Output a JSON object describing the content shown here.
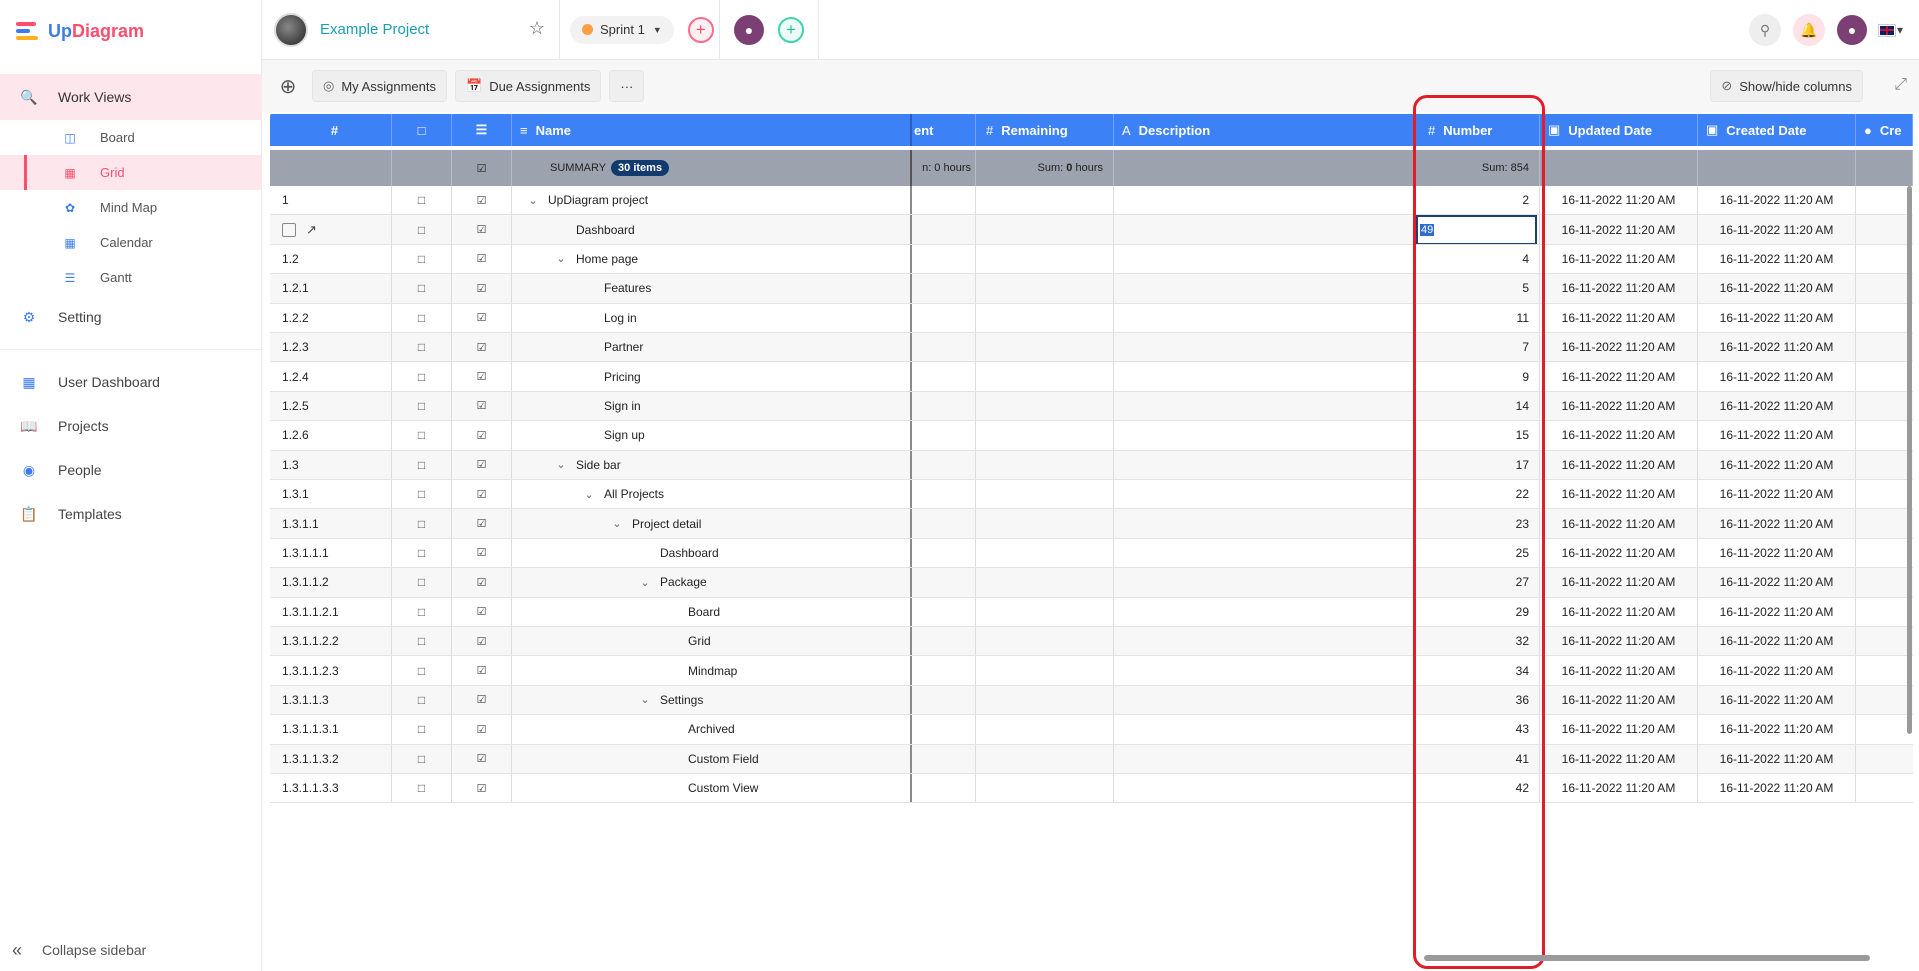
{
  "app": {
    "logo_text_a": "Up",
    "logo_text_b": "Diagram"
  },
  "sidebar": {
    "work_views": "Work Views",
    "sub_items": [
      {
        "label": "Board",
        "icon": "board-icon"
      },
      {
        "label": "Grid",
        "icon": "grid-icon",
        "active": true
      },
      {
        "label": "Mind Map",
        "icon": "mindmap-icon"
      },
      {
        "label": "Calendar",
        "icon": "calendar-icon"
      },
      {
        "label": "Gantt",
        "icon": "gantt-icon"
      }
    ],
    "setting": "Setting",
    "user_dashboard": "User Dashboard",
    "projects": "Projects",
    "people": "People",
    "templates": "Templates",
    "collapse": "Collapse sidebar"
  },
  "topbar": {
    "project_name": "Example Project",
    "sprint": "Sprint 1"
  },
  "toolbar": {
    "my_assignments": "My Assignments",
    "due_assignments": "Due Assignments",
    "more": "···",
    "show_hide": "Show/hide columns"
  },
  "grid": {
    "headers": {
      "num": "#",
      "name": "Name",
      "spent": "ent",
      "remaining": "Remaining",
      "description": "Description",
      "number": "Number",
      "updated": "Updated Date",
      "created": "Created Date",
      "last": "Cre"
    },
    "summary": {
      "label": "SUMMARY",
      "count": "30 items",
      "spent": "n: 0 hours",
      "remaining_label": "Sum:",
      "remaining_value": "0",
      "remaining_unit": "hours",
      "number": "Sum: 854"
    },
    "editing_value": "49",
    "rows": [
      {
        "num": "1",
        "name": "UpDiagram project",
        "level": 0,
        "expand": true,
        "number": "2"
      },
      {
        "num": "",
        "name": "Dashboard",
        "level": 1,
        "expand": false,
        "number": "49",
        "editing": true
      },
      {
        "num": "1.2",
        "name": "Home page",
        "level": 1,
        "expand": true,
        "number": "4"
      },
      {
        "num": "1.2.1",
        "name": "Features",
        "level": 2,
        "expand": false,
        "number": "5"
      },
      {
        "num": "1.2.2",
        "name": "Log in",
        "level": 2,
        "expand": false,
        "number": "11"
      },
      {
        "num": "1.2.3",
        "name": "Partner",
        "level": 2,
        "expand": false,
        "number": "7"
      },
      {
        "num": "1.2.4",
        "name": "Pricing",
        "level": 2,
        "expand": false,
        "number": "9"
      },
      {
        "num": "1.2.5",
        "name": "Sign in",
        "level": 2,
        "expand": false,
        "number": "14"
      },
      {
        "num": "1.2.6",
        "name": "Sign up",
        "level": 2,
        "expand": false,
        "number": "15"
      },
      {
        "num": "1.3",
        "name": "Side bar",
        "level": 1,
        "expand": true,
        "number": "17"
      },
      {
        "num": "1.3.1",
        "name": "All Projects",
        "level": 2,
        "expand": true,
        "number": "22"
      },
      {
        "num": "1.3.1.1",
        "name": "Project detail",
        "level": 3,
        "expand": true,
        "number": "23"
      },
      {
        "num": "1.3.1.1.1",
        "name": "Dashboard",
        "level": 4,
        "expand": false,
        "number": "25"
      },
      {
        "num": "1.3.1.1.2",
        "name": "Package",
        "level": 4,
        "expand": true,
        "number": "27"
      },
      {
        "num": "1.3.1.1.2.1",
        "name": "Board",
        "level": 5,
        "expand": false,
        "number": "29"
      },
      {
        "num": "1.3.1.1.2.2",
        "name": "Grid",
        "level": 5,
        "expand": false,
        "number": "32"
      },
      {
        "num": "1.3.1.1.2.3",
        "name": "Mindmap",
        "level": 5,
        "expand": false,
        "number": "34"
      },
      {
        "num": "1.3.1.1.3",
        "name": "Settings",
        "level": 4,
        "expand": true,
        "number": "36"
      },
      {
        "num": "1.3.1.1.3.1",
        "name": "Archived",
        "level": 5,
        "expand": false,
        "number": "43"
      },
      {
        "num": "1.3.1.1.3.2",
        "name": "Custom Field",
        "level": 5,
        "expand": false,
        "number": "41"
      },
      {
        "num": "1.3.1.1.3.3",
        "name": "Custom View",
        "level": 5,
        "expand": false,
        "number": "42"
      }
    ],
    "date": "16-11-2022 11:20 AM"
  },
  "colors": {
    "accent": "#ff4d6d",
    "header_blue": "#3c82f6",
    "highlight": "#e11d2a"
  }
}
